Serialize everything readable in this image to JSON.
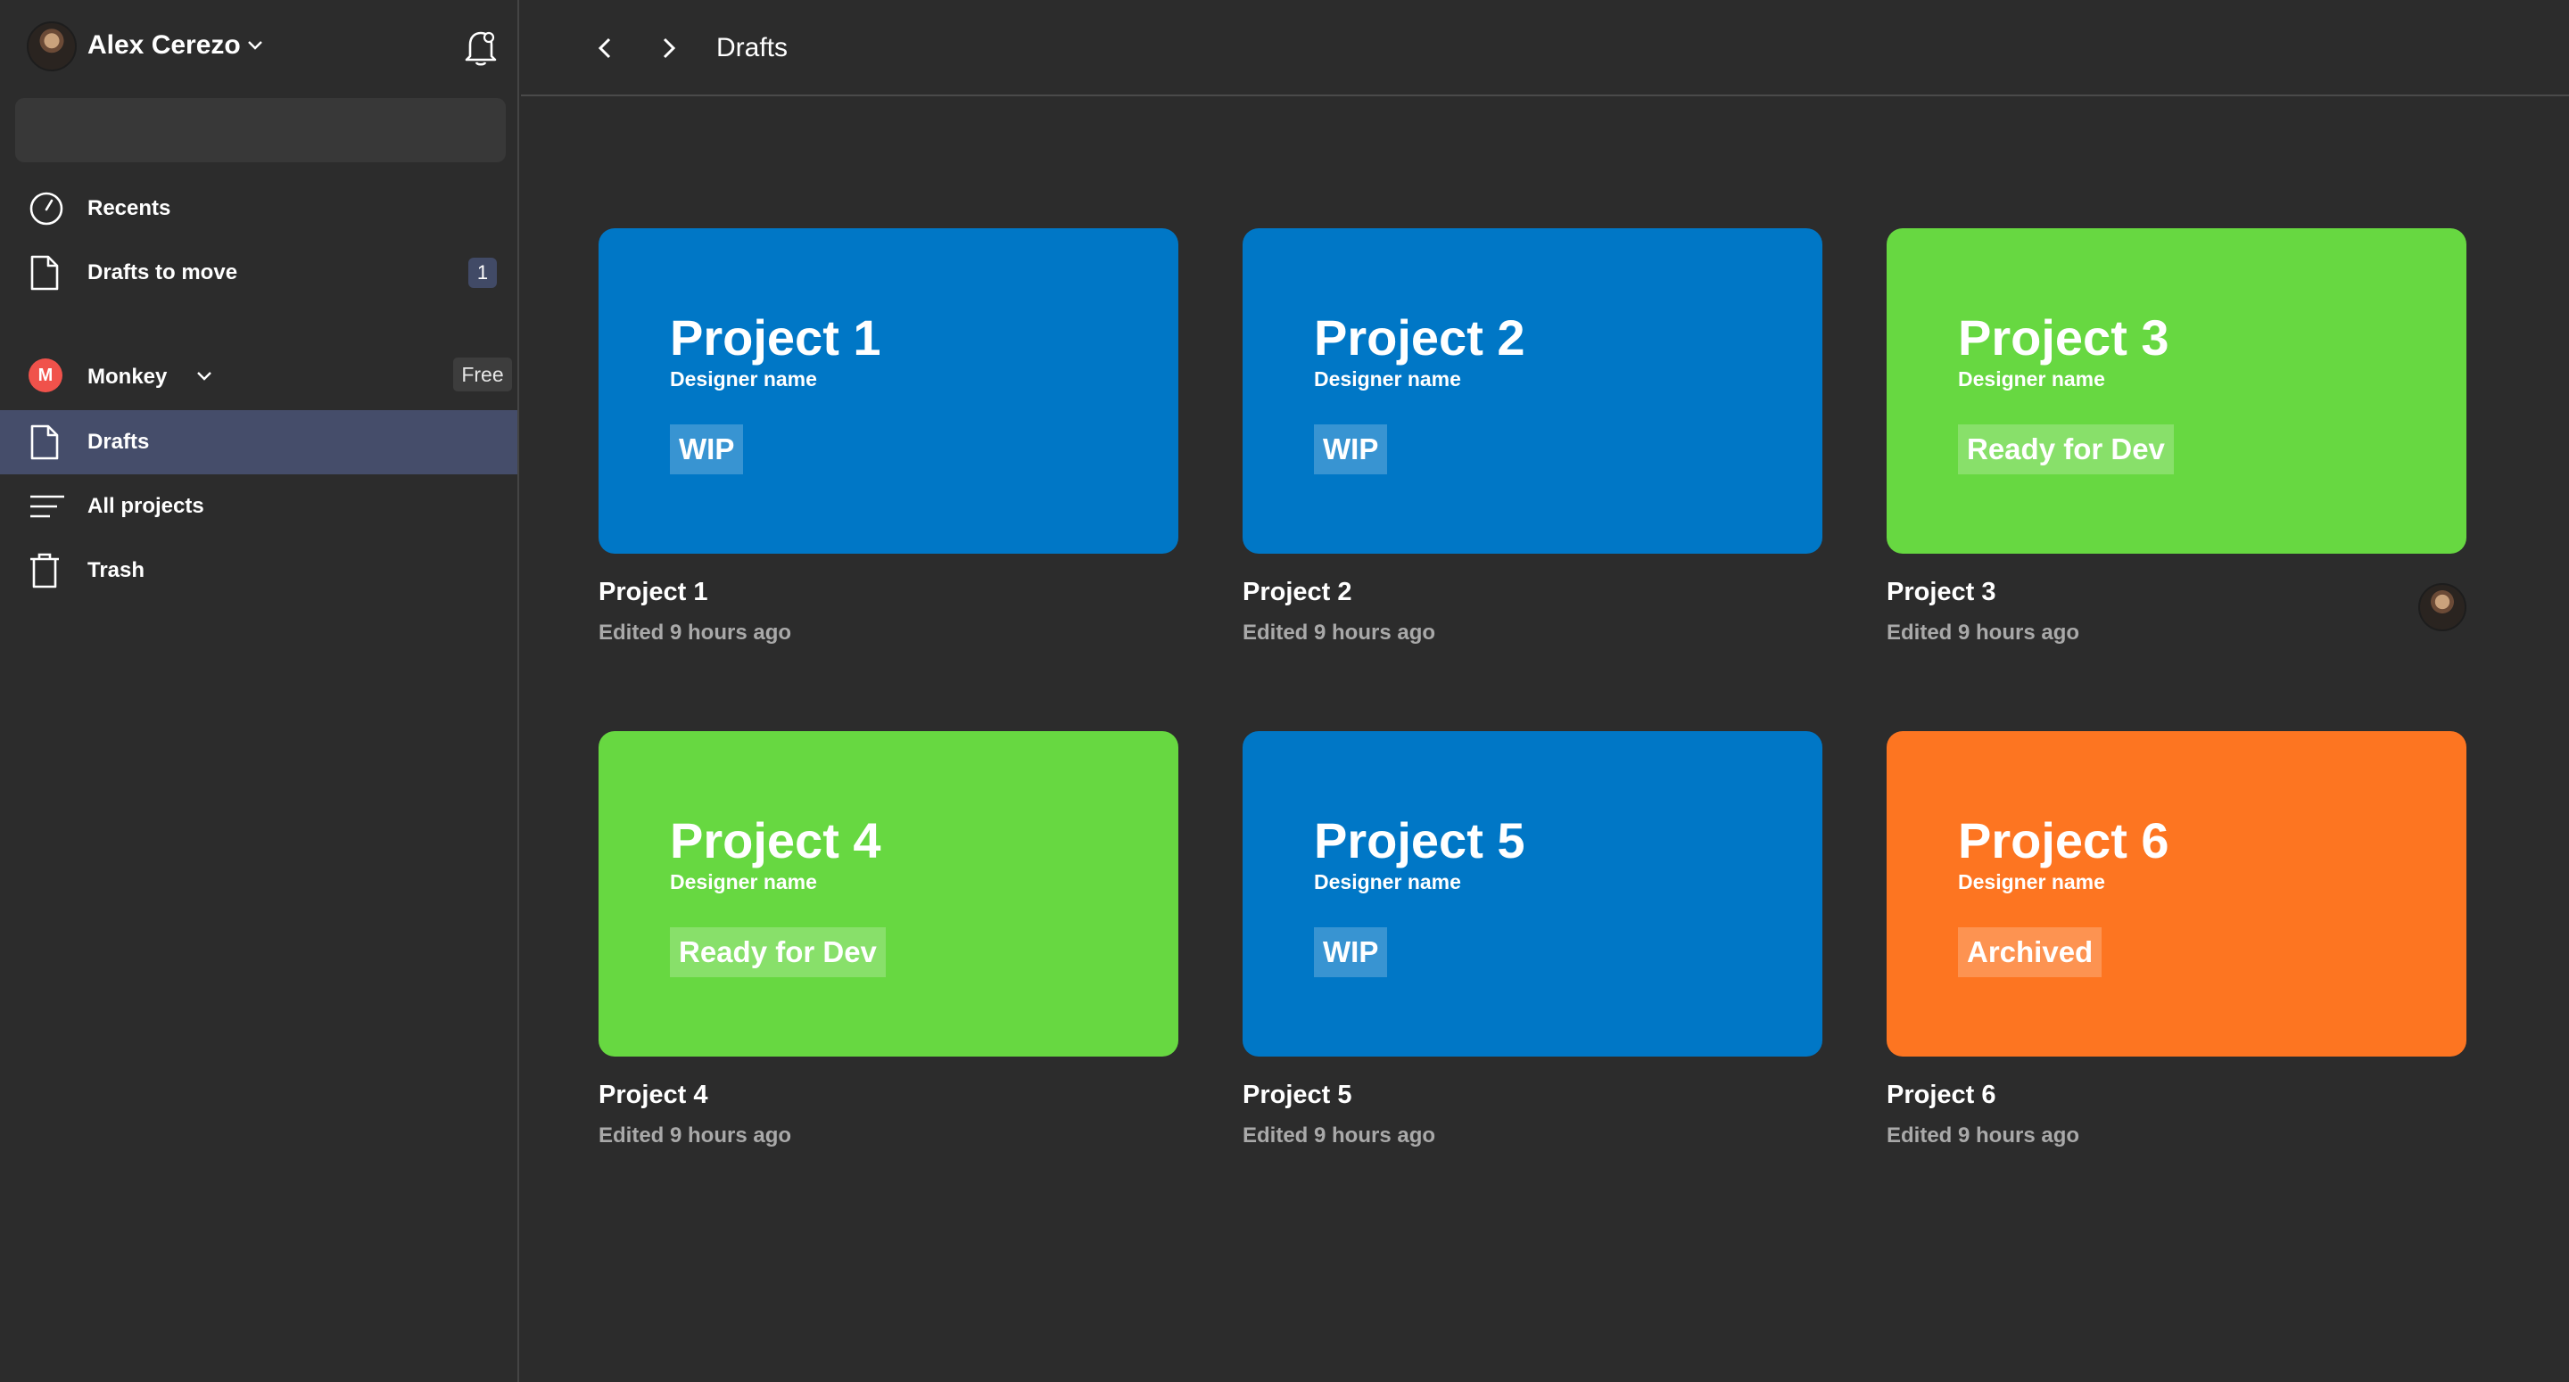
{
  "user": {
    "name": "Alex Cerezo"
  },
  "nav": {
    "recents": "Recents",
    "drafts_to_move": "Drafts to move",
    "drafts_to_move_count": "1"
  },
  "team": {
    "initial": "M",
    "name": "Monkey",
    "plan": "Free"
  },
  "team_nav": {
    "drafts": "Drafts",
    "all_projects": "All projects",
    "trash": "Trash"
  },
  "topbar": {
    "title": "Drafts"
  },
  "projects": [
    {
      "title": "Project 1",
      "subtitle": "Designer name",
      "status": "WIP",
      "name": "Project 1",
      "edited": "Edited 9 hours ago",
      "color": "#0077c6"
    },
    {
      "title": "Project 2",
      "subtitle": "Designer name",
      "status": "WIP",
      "name": "Project 2",
      "edited": "Edited 9 hours ago",
      "color": "#0077c6"
    },
    {
      "title": "Project 3",
      "subtitle": "Designer name",
      "status": "Ready for Dev",
      "name": "Project 3",
      "edited": "Edited 9 hours ago",
      "color": "#67d841"
    },
    {
      "title": "Project 4",
      "subtitle": "Designer name",
      "status": "Ready for Dev",
      "name": "Project 4",
      "edited": "Edited 9 hours ago",
      "color": "#67d841"
    },
    {
      "title": "Project 5",
      "subtitle": "Designer name",
      "status": "WIP",
      "name": "Project 5",
      "edited": "Edited 9 hours ago",
      "color": "#0077c6"
    },
    {
      "title": "Project 6",
      "subtitle": "Designer name",
      "status": "Archived",
      "name": "Project 6",
      "edited": "Edited 9 hours ago",
      "color": "#fd7521"
    }
  ],
  "colors": {
    "background": "#2c2c2c",
    "active_item": "#454d6a",
    "muted_text": "#a9a9a9",
    "team_avatar": "#f0524b"
  },
  "icons": {
    "user_menu": "chevron-down-icon",
    "notifications": "bell-icon",
    "recents": "clock-icon",
    "drafts_to_move": "document-icon",
    "drafts": "document-icon",
    "all_projects": "list-icon",
    "trash": "trash-icon",
    "back": "chevron-left-icon",
    "forward": "chevron-right-icon"
  }
}
